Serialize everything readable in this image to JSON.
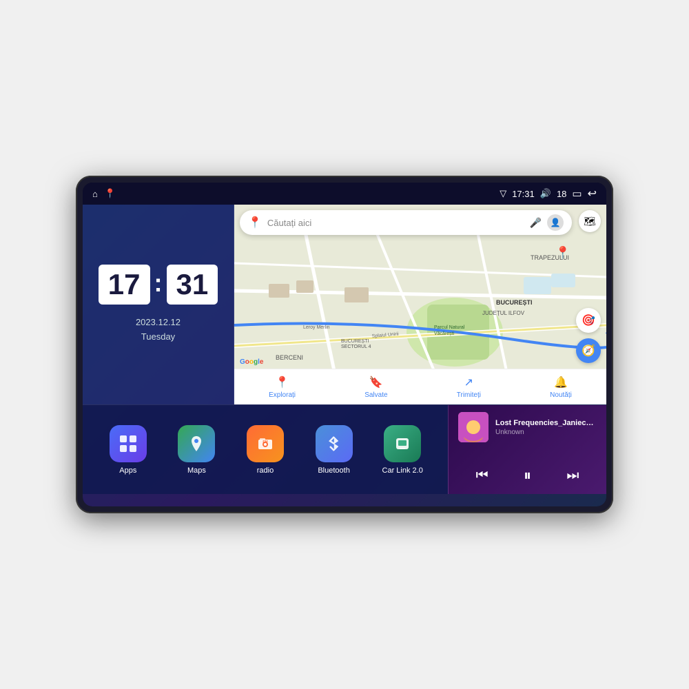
{
  "device": {
    "screen": {
      "statusBar": {
        "leftIcons": [
          "home",
          "location"
        ],
        "time": "17:31",
        "signal": "▽",
        "volume": "🔊",
        "battery": "18",
        "batteryIcon": "🔋",
        "back": "↩"
      },
      "clock": {
        "hours": "17",
        "minutes": "31",
        "date": "2023.12.12",
        "dayOfWeek": "Tuesday"
      },
      "map": {
        "searchPlaceholder": "Căutați aici",
        "googleLogo": "Google",
        "bottomNav": [
          {
            "icon": "📍",
            "label": "Explorați"
          },
          {
            "icon": "🔖",
            "label": "Salvate"
          },
          {
            "icon": "↗",
            "label": "Trimiteți"
          },
          {
            "icon": "🔔",
            "label": "Noutăți"
          }
        ],
        "mapTexts": [
          "TRAPEZULUI",
          "BUCUREȘTI",
          "JUDEȚUL ILFOV",
          "BERCENI",
          "Parcul Natural Văcărești",
          "Leroy Merlin",
          "BUCUREȘTI SECTORUL 4",
          "Splaiul Unirii"
        ]
      },
      "apps": [
        {
          "id": "apps",
          "label": "Apps",
          "iconClass": "apps-icon",
          "emoji": "⊞"
        },
        {
          "id": "maps",
          "label": "Maps",
          "iconClass": "maps-icon",
          "emoji": "📍"
        },
        {
          "id": "radio",
          "label": "radio",
          "iconClass": "radio-icon",
          "emoji": "📻"
        },
        {
          "id": "bluetooth",
          "label": "Bluetooth",
          "iconClass": "bluetooth-icon",
          "emoji": "⬡"
        },
        {
          "id": "carlink",
          "label": "Car Link 2.0",
          "iconClass": "carlink-icon",
          "emoji": "📱"
        }
      ],
      "music": {
        "title": "Lost Frequencies_Janieck Devy-...",
        "artist": "Unknown",
        "controls": {
          "prev": "⏮",
          "play": "⏸",
          "next": "⏭"
        }
      }
    }
  }
}
